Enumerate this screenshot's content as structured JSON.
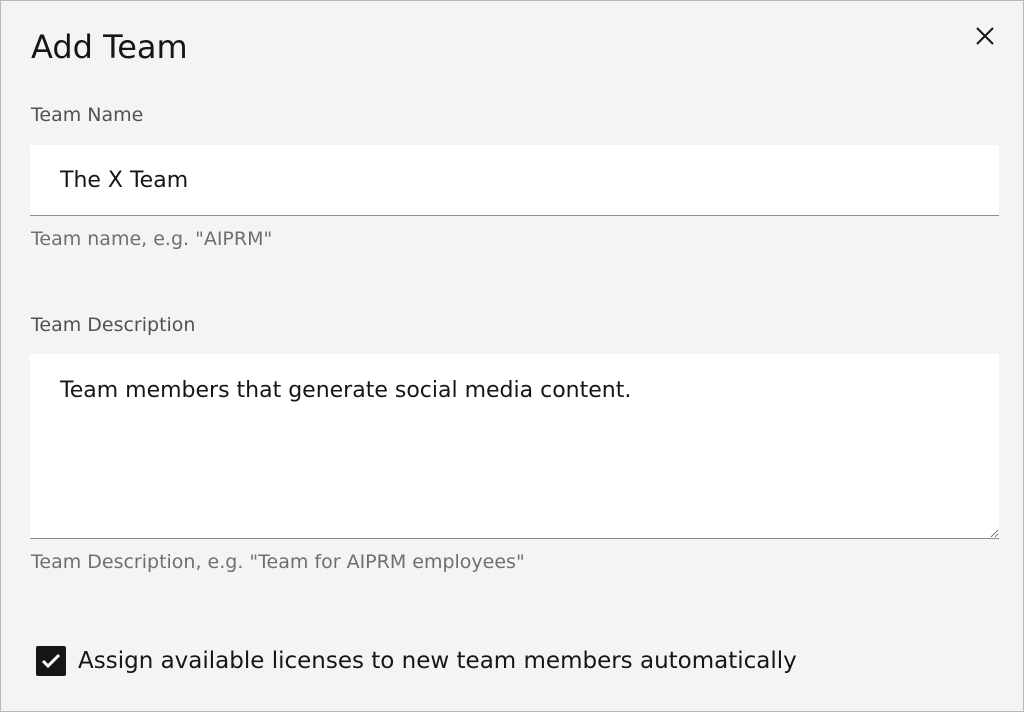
{
  "dialog": {
    "title": "Add Team",
    "close_icon": "close-icon"
  },
  "team_name": {
    "label": "Team Name",
    "value": "The X Team",
    "helper": "Team name, e.g. \"AIPRM\""
  },
  "team_description": {
    "label": "Team Description",
    "value": "Team members that generate social media content.",
    "helper": "Team Description, e.g. \"Team for AIPRM employees\""
  },
  "auto_assign": {
    "checked": true,
    "label": "Assign available licenses to new team members automatically",
    "icon": "checkmark-icon"
  },
  "colors": {
    "background": "#f4f4f4",
    "input_background": "#ffffff",
    "checkbox_fill": "#161616"
  }
}
